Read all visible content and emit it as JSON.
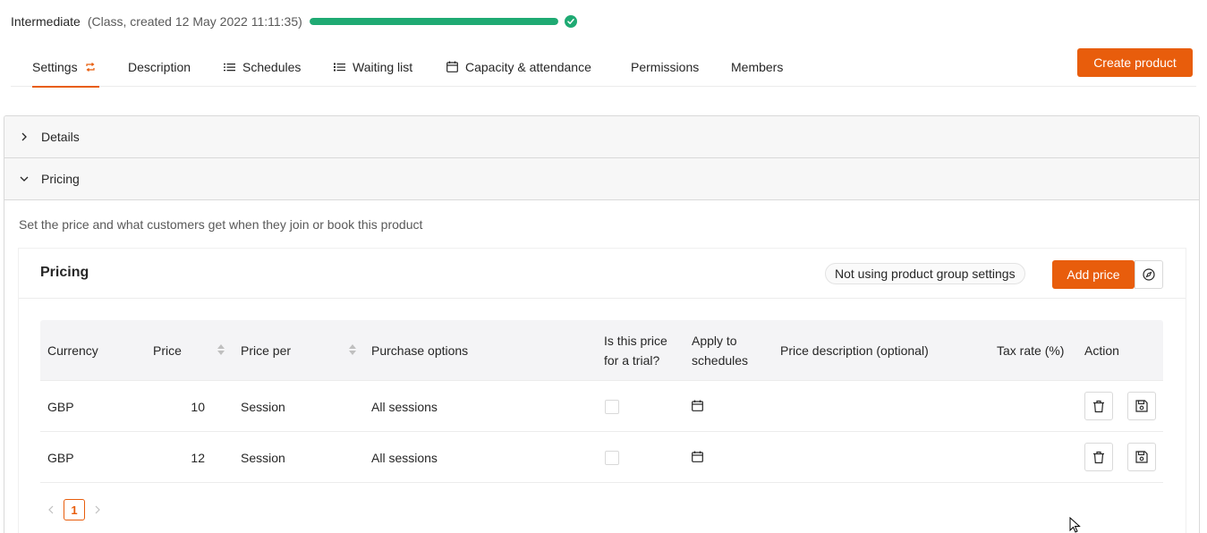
{
  "product": {
    "name": "Intermediate",
    "meta": "(Class, created 12 May 2022 11:11:35)",
    "progress": 1.0
  },
  "tabs": [
    {
      "label": "Settings",
      "icon": "sync-icon",
      "active": true
    },
    {
      "label": "Description",
      "icon": null
    },
    {
      "label": "Schedules",
      "icon": "list-icon"
    },
    {
      "label": "Waiting list",
      "icon": "ordered-list-icon"
    },
    {
      "label": "Capacity & attendance",
      "icon": "calendar-icon"
    },
    {
      "label": "Permissions",
      "icon": null
    },
    {
      "label": "Members",
      "icon": null
    }
  ],
  "create_product_label": "Create product",
  "panels": {
    "details_label": "Details",
    "pricing_label": "Pricing",
    "pricing_description": "Set the price and what customers get when they join or book this product"
  },
  "pricing_card": {
    "title": "Pricing",
    "group_settings": "Not using product group settings",
    "add_price_label": "Add price"
  },
  "table": {
    "headers": {
      "currency": "Currency",
      "price": "Price",
      "price_per": "Price per",
      "purchase_options": "Purchase options",
      "trial_line1": "Is this price",
      "trial_line2": "for a trial?",
      "apply_line1": "Apply to",
      "apply_line2": "schedules",
      "price_description": "Price description (optional)",
      "tax_rate": "Tax rate (%)",
      "action": "Action"
    },
    "rows": [
      {
        "currency": "GBP",
        "price": "10",
        "price_per": "Session",
        "purchase_options": "All sessions",
        "trial": false
      },
      {
        "currency": "GBP",
        "price": "12",
        "price_per": "Session",
        "purchase_options": "All sessions",
        "trial": false
      }
    ]
  },
  "pagination": {
    "current_page": "1"
  },
  "colors": {
    "accent": "#e85d0c",
    "success": "#1faa73"
  }
}
